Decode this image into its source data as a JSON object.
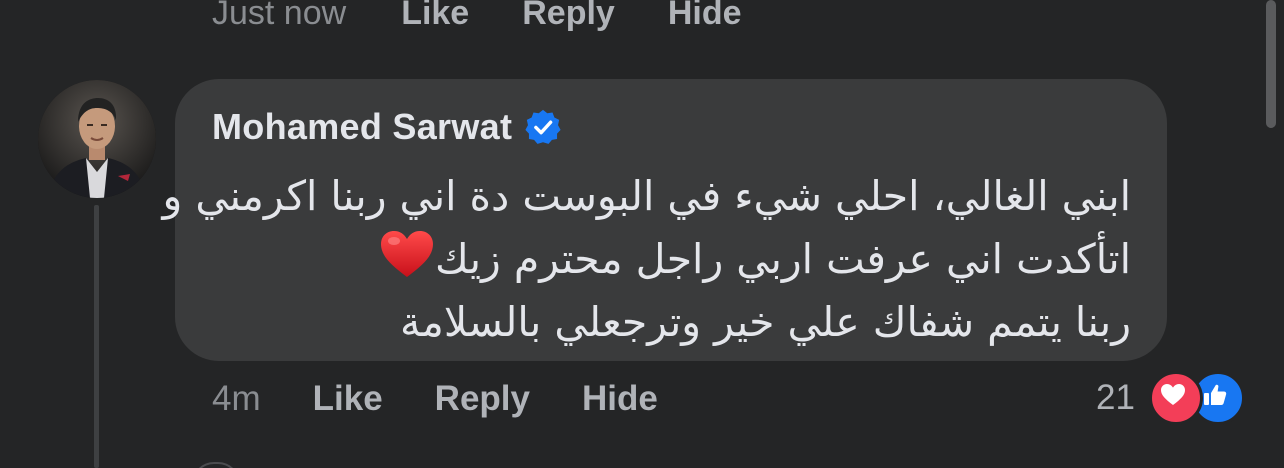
{
  "previous_comment": {
    "time": "Just now",
    "actions": [
      "Like",
      "Reply",
      "Hide"
    ]
  },
  "comment": {
    "author": "Mohamed Sarwat",
    "verified_icon": "verified-badge-icon",
    "lines": [
      "ابني الغالي، احلي شيء في البوست دة اني ربنا اكرمني و",
      "اتأكدت اني عرفت اربي راجل محترم زيك",
      "ربنا يتمم شفاك علي خير وترجعلي بالسلامة"
    ],
    "emoji": "red-heart",
    "time": "4m",
    "actions": {
      "like": "Like",
      "reply": "Reply",
      "hide": "Hide"
    },
    "reaction_count": "21",
    "reactions": [
      "love-reaction-icon",
      "like-reaction-icon"
    ]
  },
  "colors": {
    "background": "#242526",
    "bubble": "#3a3b3c",
    "verified": "#1877f2",
    "love": "#f33e58",
    "like": "#1877f2"
  }
}
